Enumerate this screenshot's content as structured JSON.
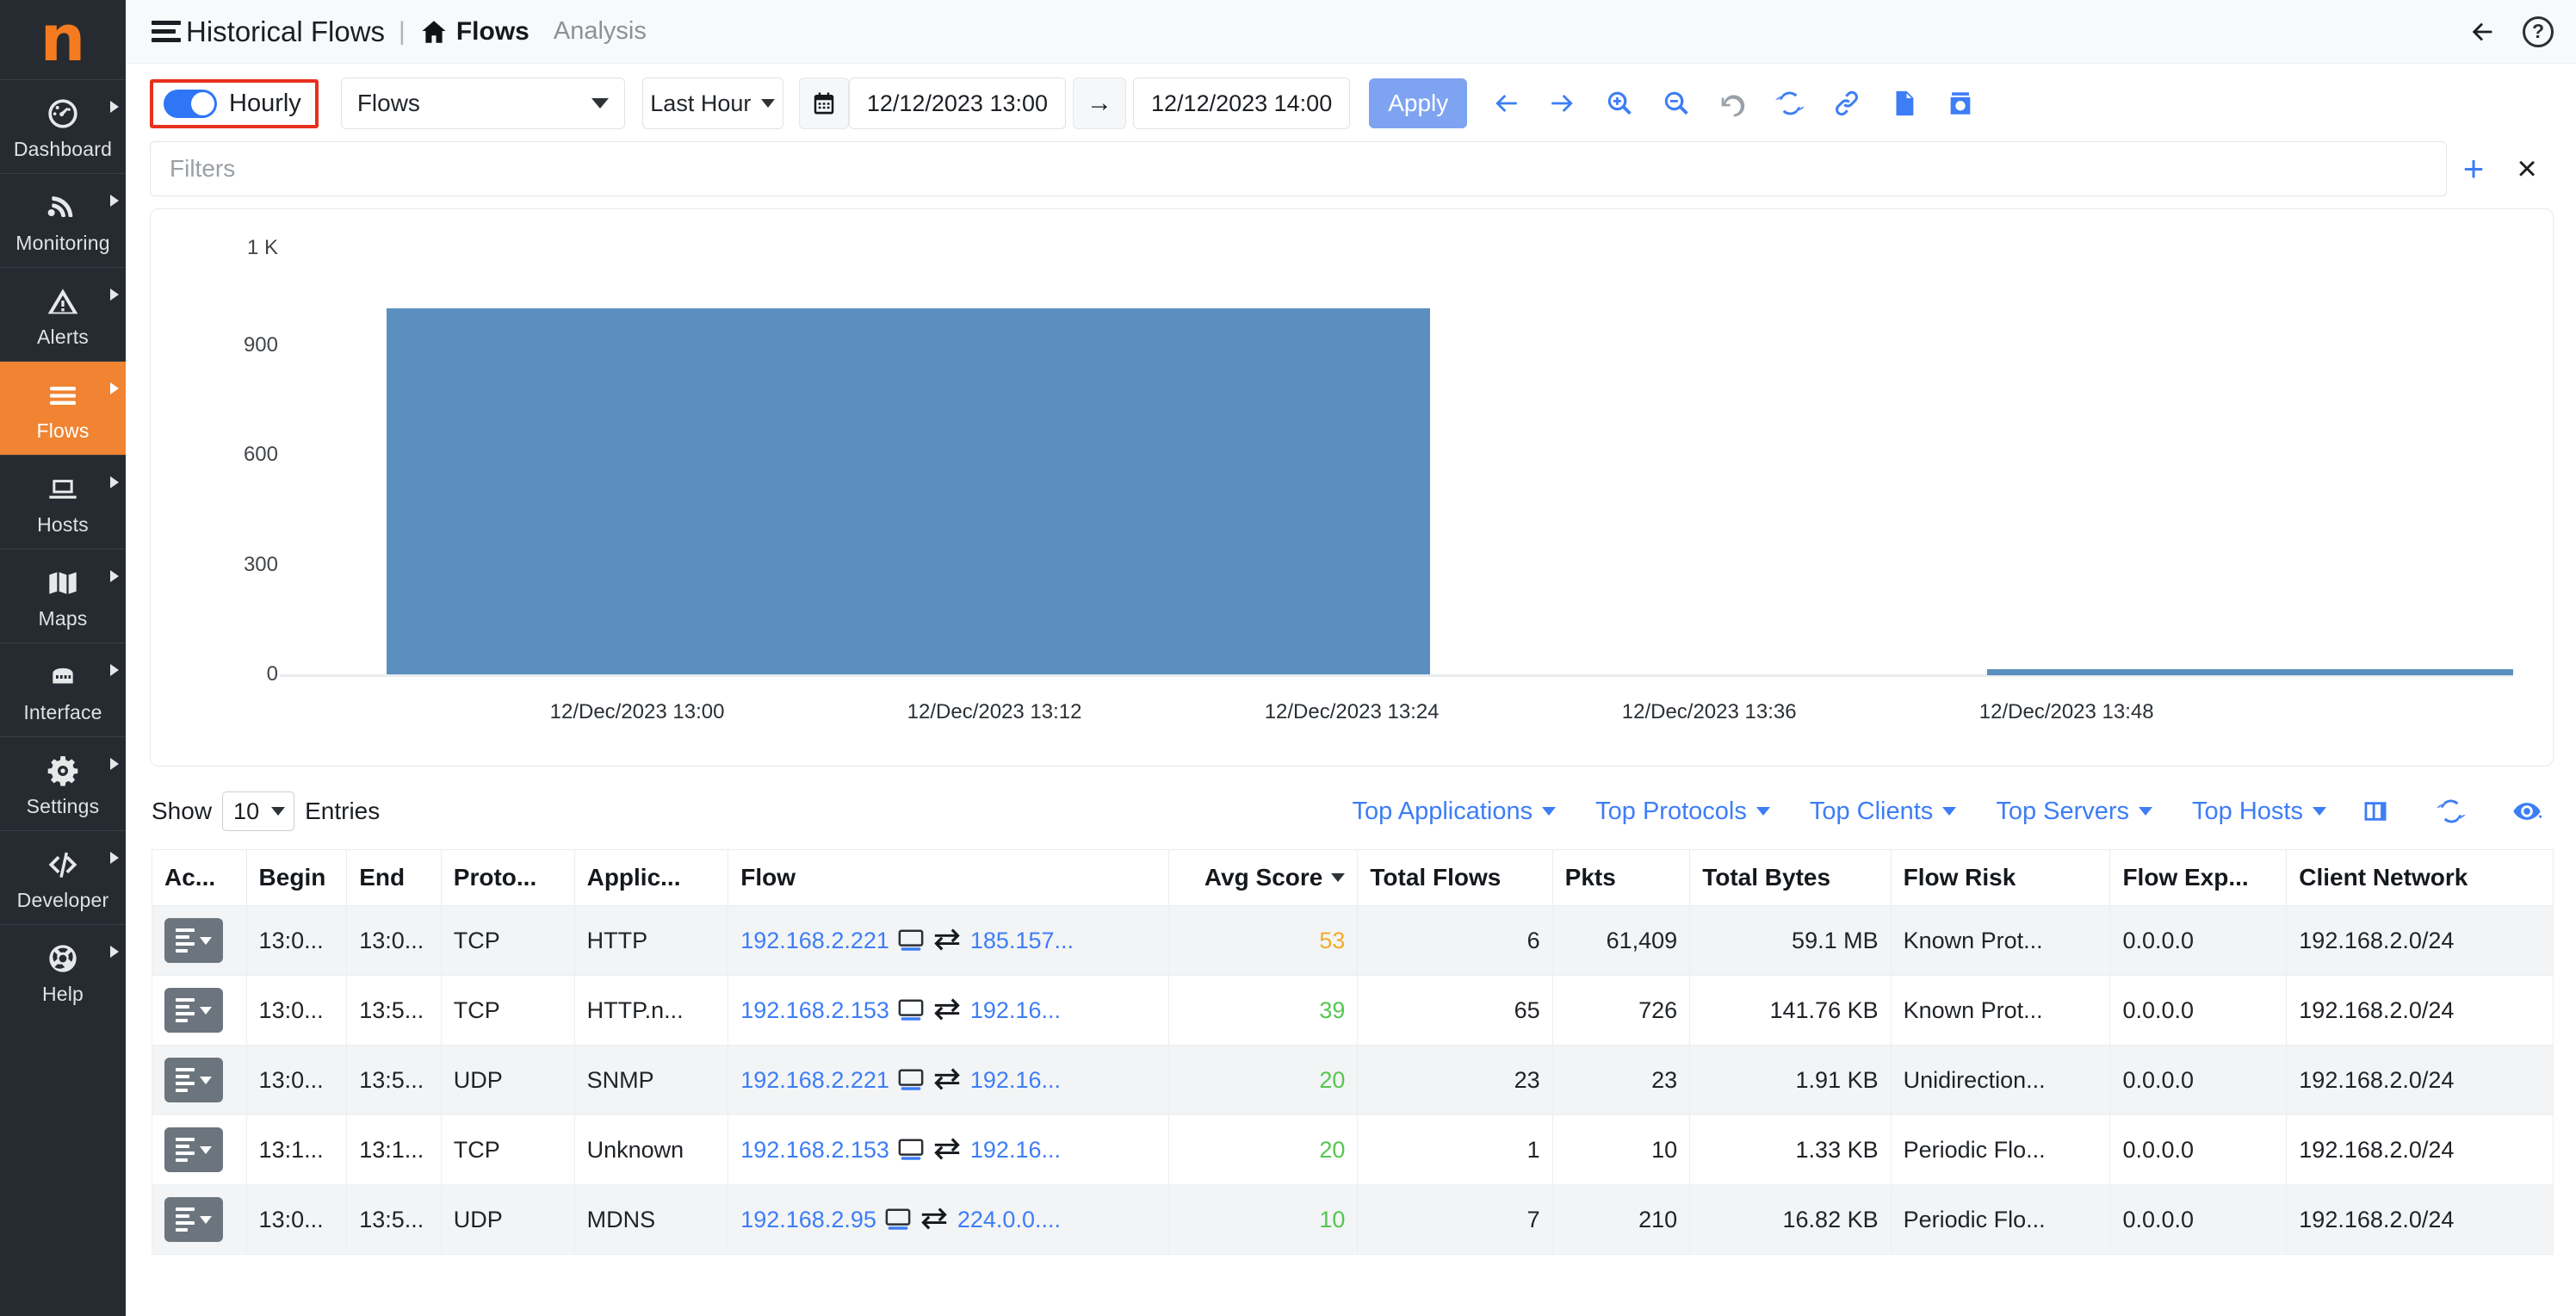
{
  "brand": {
    "logo_letter": "n",
    "accent": "#f08432"
  },
  "sidebar": {
    "items": [
      {
        "label": "Dashboard",
        "icon": "dashboard-icon"
      },
      {
        "label": "Monitoring",
        "icon": "monitoring-icon"
      },
      {
        "label": "Alerts",
        "icon": "alerts-icon"
      },
      {
        "label": "Flows",
        "icon": "flows-icon",
        "active": true
      },
      {
        "label": "Hosts",
        "icon": "hosts-icon"
      },
      {
        "label": "Maps",
        "icon": "maps-icon"
      },
      {
        "label": "Interface",
        "icon": "interface-icon"
      },
      {
        "label": "Settings",
        "icon": "settings-icon"
      },
      {
        "label": "Developer",
        "icon": "developer-icon"
      },
      {
        "label": "Help",
        "icon": "help-icon"
      }
    ]
  },
  "header": {
    "title": "Historical Flows",
    "separator": "|",
    "breadcrumb_current": "Flows",
    "breadcrumb_secondary": "Analysis",
    "help_label": "?"
  },
  "toolbar": {
    "hourly_label": "Hourly",
    "hourly_on": true,
    "flows_select": "Flows",
    "range_select": "Last Hour",
    "date_from": "12/12/2023 13:00",
    "date_to": "12/12/2023 14:00",
    "range_arrow": "→",
    "apply_label": "Apply",
    "icons": [
      "arrow-left-icon",
      "arrow-right-icon",
      "zoom-in-icon",
      "zoom-out-icon",
      "undo-icon",
      "refresh-icon",
      "link-icon",
      "file-icon",
      "snapshot-icon"
    ]
  },
  "filters": {
    "placeholder": "Filters",
    "add_label": "+",
    "clear_label": "×"
  },
  "chart_data": {
    "type": "bar",
    "title": "",
    "xlabel": "",
    "ylabel": "",
    "ylim": [
      0,
      1000
    ],
    "ytick_labels": [
      "0",
      "300",
      "600",
      "900",
      "1 K"
    ],
    "ytick_values": [
      0,
      300,
      600,
      900,
      1000
    ],
    "xtick_labels": [
      "12/Dec/2023 13:00",
      "12/Dec/2023 13:12",
      "12/Dec/2023 13:24",
      "12/Dec/2023 13:36",
      "12/Dec/2023 13:48"
    ],
    "series": [
      {
        "name": "Flows",
        "color": "#5b8fc0",
        "bars": [
          {
            "x_label": "12/Dec/2023 13:00",
            "value": 990,
            "span_start_pct": 4.5,
            "span_end_pct": 48.5
          },
          {
            "x_label": "12/Dec/2023 13:42",
            "value": 6,
            "span_start_pct": 72.0,
            "span_end_pct": 110.0
          }
        ]
      }
    ],
    "grid": false,
    "legend": "none"
  },
  "table_controls": {
    "show_label": "Show",
    "entries_label": "Entries",
    "page_size": "10",
    "dropdowns": [
      "Top Applications",
      "Top Protocols",
      "Top Clients",
      "Top Servers",
      "Top Hosts"
    ],
    "icons": [
      "columns-icon",
      "refresh-icon",
      "eye-icon"
    ]
  },
  "table": {
    "columns": [
      "Ac...",
      "Begin",
      "End",
      "Proto...",
      "Applic...",
      "Flow",
      "Avg Score",
      "Total Flows",
      "Pkts",
      "Total Bytes",
      "Flow Risk",
      "Flow Exp...",
      "Client Network"
    ],
    "sorted_column": "Avg Score",
    "sort_dir": "desc",
    "rows": [
      {
        "begin": "13:0...",
        "end": "13:0...",
        "proto": "TCP",
        "application": "HTTP",
        "flow_src": "192.168.2.221",
        "flow_dst": "185.157...",
        "avg_score": "53",
        "score_level": "amber",
        "total_flows": "6",
        "pkts": "61,409",
        "total_bytes": "59.1 MB",
        "flow_risk": "Known Prot...",
        "flow_exp": "0.0.0.0",
        "client_network": "192.168.2.0/24"
      },
      {
        "begin": "13:0...",
        "end": "13:5...",
        "proto": "TCP",
        "application": "HTTP.n...",
        "flow_src": "192.168.2.153",
        "flow_dst": "192.16...",
        "avg_score": "39",
        "score_level": "green",
        "total_flows": "65",
        "pkts": "726",
        "total_bytes": "141.76 KB",
        "flow_risk": "Known Prot...",
        "flow_exp": "0.0.0.0",
        "client_network": "192.168.2.0/24"
      },
      {
        "begin": "13:0...",
        "end": "13:5...",
        "proto": "UDP",
        "application": "SNMP",
        "flow_src": "192.168.2.221",
        "flow_dst": "192.16...",
        "avg_score": "20",
        "score_level": "green",
        "total_flows": "23",
        "pkts": "23",
        "total_bytes": "1.91 KB",
        "flow_risk": "Unidirection...",
        "flow_exp": "0.0.0.0",
        "client_network": "192.168.2.0/24"
      },
      {
        "begin": "13:1...",
        "end": "13:1...",
        "proto": "TCP",
        "application": "Unknown",
        "flow_src": "192.168.2.153",
        "flow_dst": "192.16...",
        "avg_score": "20",
        "score_level": "green",
        "total_flows": "1",
        "pkts": "10",
        "total_bytes": "1.33 KB",
        "flow_risk": "Periodic Flo...",
        "flow_exp": "0.0.0.0",
        "client_network": "192.168.2.0/24"
      },
      {
        "begin": "13:0...",
        "end": "13:5...",
        "proto": "UDP",
        "application": "MDNS",
        "flow_src": "192.168.2.95",
        "flow_dst": "224.0.0....",
        "avg_score": "10",
        "score_level": "green",
        "total_flows": "7",
        "pkts": "210",
        "total_bytes": "16.82 KB",
        "flow_risk": "Periodic Flo...",
        "flow_exp": "0.0.0.0",
        "client_network": "192.168.2.0/24"
      }
    ]
  }
}
